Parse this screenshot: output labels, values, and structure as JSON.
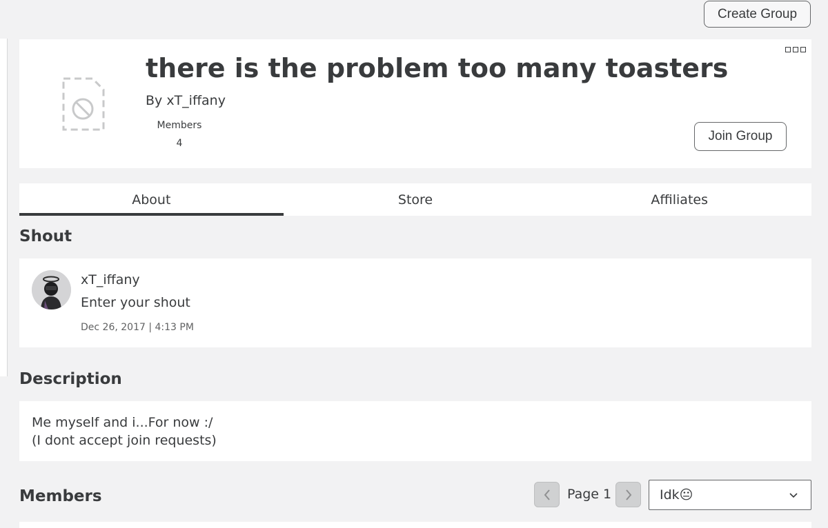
{
  "toolbar": {
    "create_group_label": "Create Group"
  },
  "group": {
    "name": "there is the problem too many toasters",
    "owner_line": "By xT_iffany",
    "members_label": "Members",
    "members_count": "4",
    "join_label": "Join Group",
    "emblem_icon": "image-unavailable-icon",
    "more_icon": "more-options-icon"
  },
  "tabs": [
    {
      "label": "About",
      "active": true
    },
    {
      "label": "Store",
      "active": false
    },
    {
      "label": "Affiliates",
      "active": false
    }
  ],
  "shout": {
    "heading": "Shout",
    "username": "xT_iffany",
    "text": "Enter your shout",
    "date": "Dec 26, 2017 | 4:13 PM"
  },
  "description": {
    "heading": "Description",
    "line1": "Me myself and i...For now :/",
    "line2": "(I dont accept join requests)"
  },
  "members": {
    "heading": "Members",
    "page_label": "Page 1",
    "prev_icon": "chevron-left-icon",
    "next_icon": "chevron-right-icon",
    "role_selected": "Idk😐"
  },
  "colors": {
    "background": "#f2f2f3",
    "card": "#ffffff",
    "text": "#393b3d",
    "tab_indicator": "#393b3d"
  }
}
